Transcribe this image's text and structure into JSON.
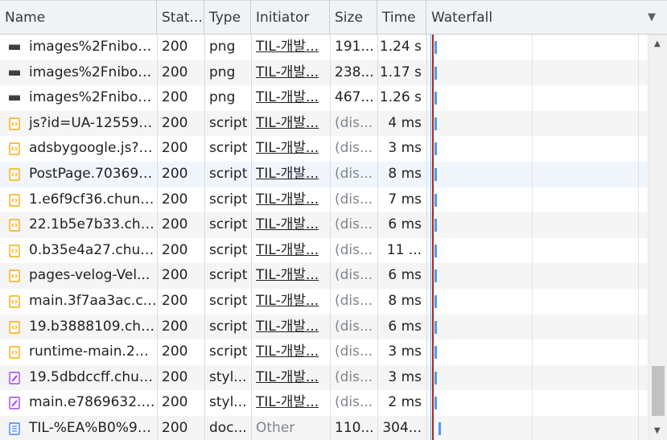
{
  "columns": {
    "name": "Name",
    "status": "Stat...",
    "type": "Type",
    "initiator": "Initiator",
    "size": "Size",
    "time": "Time",
    "waterfall": "Waterfall",
    "sort_indicator": "▼"
  },
  "rows": [
    {
      "icon": "image-icon",
      "name": "images%2Fniboo...",
      "status": "200",
      "type": "png",
      "initiator": "TIL-개발...",
      "size": "191...",
      "time": "1.24 s",
      "size_muted": false
    },
    {
      "icon": "image-icon",
      "name": "images%2Fniboo...",
      "status": "200",
      "type": "png",
      "initiator": "TIL-개발...",
      "size": "238...",
      "time": "1.17 s",
      "size_muted": false
    },
    {
      "icon": "image-icon",
      "name": "images%2Fniboo...",
      "status": "200",
      "type": "png",
      "initiator": "TIL-개발...",
      "size": "467...",
      "time": "1.26 s",
      "size_muted": false
    },
    {
      "icon": "script-icon",
      "name": "js?id=UA-125599...",
      "status": "200",
      "type": "script",
      "initiator": "TIL-개발...",
      "size": "(dis...",
      "time": "4 ms",
      "size_muted": true
    },
    {
      "icon": "script-icon",
      "name": "adsbygoogle.js?c...",
      "status": "200",
      "type": "script",
      "initiator": "TIL-개발...",
      "size": "(dis...",
      "time": "3 ms",
      "size_muted": true
    },
    {
      "icon": "script-icon",
      "name": "PostPage.70369b...",
      "status": "200",
      "type": "script",
      "initiator": "TIL-개발...",
      "size": "(dis...",
      "time": "8 ms",
      "size_muted": true
    },
    {
      "icon": "script-icon",
      "name": "1.e6f9cf36.chunk.js",
      "status": "200",
      "type": "script",
      "initiator": "TIL-개발...",
      "size": "(dis...",
      "time": "7 ms",
      "size_muted": true
    },
    {
      "icon": "script-icon",
      "name": "22.1b5e7b33.chun...",
      "status": "200",
      "type": "script",
      "initiator": "TIL-개발...",
      "size": "(dis...",
      "time": "6 ms",
      "size_muted": true
    },
    {
      "icon": "script-icon",
      "name": "0.b35e4a27.chun...",
      "status": "200",
      "type": "script",
      "initiator": "TIL-개발...",
      "size": "(dis...",
      "time": "11 ...",
      "size_muted": true
    },
    {
      "icon": "script-icon",
      "name": "pages-velog-Vel...",
      "status": "200",
      "type": "script",
      "initiator": "TIL-개발...",
      "size": "(dis...",
      "time": "6 ms",
      "size_muted": true
    },
    {
      "icon": "script-icon",
      "name": "main.3f7aa3ac.ch...",
      "status": "200",
      "type": "script",
      "initiator": "TIL-개발...",
      "size": "(dis...",
      "time": "8 ms",
      "size_muted": true
    },
    {
      "icon": "script-icon",
      "name": "19.b3888109.chu...",
      "status": "200",
      "type": "script",
      "initiator": "TIL-개발...",
      "size": "(dis...",
      "time": "6 ms",
      "size_muted": true
    },
    {
      "icon": "script-icon",
      "name": "runtime-main.2df...",
      "status": "200",
      "type": "script",
      "initiator": "TIL-개발...",
      "size": "(dis...",
      "time": "3 ms",
      "size_muted": true
    },
    {
      "icon": "stylesheet-icon",
      "name": "19.5dbdccff.chun...",
      "status": "200",
      "type": "styl...",
      "initiator": "TIL-개발...",
      "size": "(dis...",
      "time": "3 ms",
      "size_muted": true
    },
    {
      "icon": "stylesheet-icon",
      "name": "main.e7869632.c...",
      "status": "200",
      "type": "styl...",
      "initiator": "TIL-개발...",
      "size": "(dis...",
      "time": "2 ms",
      "size_muted": true
    },
    {
      "icon": "document-icon",
      "name": "TIL-%EA%B0%9C...",
      "status": "200",
      "type": "doc...",
      "initiator": "Other",
      "size": "110...",
      "time": "304...",
      "size_muted": false
    }
  ],
  "colors": {
    "script_icon": "#f9ab00",
    "stylesheet_icon": "#a142f4",
    "document_icon": "#4285f4",
    "image_icon": "#3c4043",
    "waterfall_bar": "#4a9de8",
    "load_line": "#a3272a"
  }
}
